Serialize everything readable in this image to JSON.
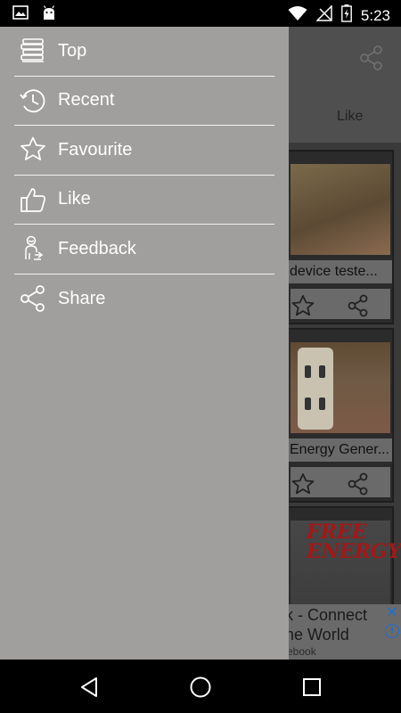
{
  "status_bar": {
    "time": "5:23",
    "icons": [
      "image-icon",
      "android-icon",
      "wifi-icon",
      "no-signal-icon",
      "battery-charging-icon"
    ]
  },
  "app": {
    "tab_like": "Like",
    "cards": [
      {
        "title": "device teste..."
      },
      {
        "title": "Energy Gener..."
      },
      {
        "title": "",
        "thumb_text_1": "FREE",
        "thumb_text_2": "ENERGY"
      }
    ],
    "ad": {
      "line1": "k - Connect",
      "line2": "he World",
      "line3": "ebook",
      "close": "✕",
      "info": "i"
    }
  },
  "drawer": {
    "items": [
      {
        "label": "Top",
        "icon": "books-stack-icon"
      },
      {
        "label": "Recent",
        "icon": "history-clock-icon"
      },
      {
        "label": "Favourite",
        "icon": "star-icon"
      },
      {
        "label": "Like",
        "icon": "thumbs-up-icon"
      },
      {
        "label": "Feedback",
        "icon": "feedback-person-icon"
      },
      {
        "label": "Share",
        "icon": "share-icon"
      }
    ]
  },
  "nav_bar": {
    "buttons": [
      "back",
      "home",
      "recents"
    ]
  },
  "colors": {
    "drawer_bg": "#a09f9d",
    "ad_accent": "#1a6fd1",
    "free_energy_red": "#a21818"
  }
}
